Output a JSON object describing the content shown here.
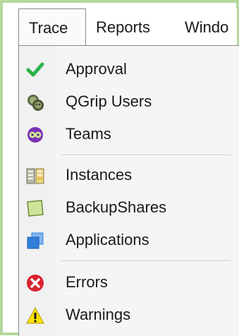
{
  "menubar": {
    "tabs": [
      {
        "label": "Trace",
        "active": true
      },
      {
        "label": "Reports"
      },
      {
        "label": "Windo"
      }
    ]
  },
  "dropdown": {
    "items": [
      {
        "label": "Approval",
        "icon": "check-icon"
      },
      {
        "label": "QGrip Users",
        "icon": "users-icon"
      },
      {
        "label": "Teams",
        "icon": "teams-icon"
      },
      {
        "label": "Instances",
        "icon": "instances-icon"
      },
      {
        "label": "BackupShares",
        "icon": "backup-shares-icon"
      },
      {
        "label": "Applications",
        "icon": "applications-icon"
      },
      {
        "label": "Errors",
        "icon": "error-icon"
      },
      {
        "label": "Warnings",
        "icon": "warning-icon"
      }
    ]
  },
  "colors": {
    "frame_border": "#b4d89c",
    "check": "#2bb34a",
    "error": "#d9232e",
    "warning": "#ffe100",
    "teams": "#7b2fb8",
    "applications": "#2f7fd8"
  }
}
